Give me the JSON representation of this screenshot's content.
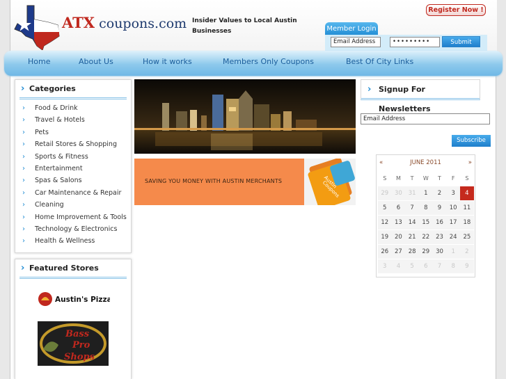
{
  "header": {
    "logo_text_a": "ATX",
    "logo_text_b": " coupons.com",
    "tagline": "Insider Values to Local Austin Businesses",
    "register_label": "Register Now !",
    "member_login_label": "Member Login",
    "email_value": "Email Address",
    "password_value": "•••••••••",
    "submit_label": "Submit"
  },
  "nav": {
    "items": [
      "Home",
      "About Us",
      "How it works",
      "Members Only Coupons",
      "Best Of City Links"
    ]
  },
  "categories": {
    "title": "Categories",
    "items": [
      "Food & Drink",
      "Travel & Hotels",
      "Pets",
      "Retail Stores & Shopping",
      "Sports & Fitness",
      "Entertainment",
      "Spas & Salons",
      "Car Maintenance & Repair",
      "Cleaning",
      "Home Improvement & Tools",
      "Technology & Electronics",
      "Health & Wellness"
    ]
  },
  "featured": {
    "title": "Featured Stores",
    "store1": "Austin's Pizza",
    "store2_a": "Bass",
    "store2_b": "Pro",
    "store2_c": "Shops"
  },
  "promo": {
    "text": "SAVING YOU MONEY WITH AUSTIN MERCHANTS",
    "card_a": "Austin",
    "card_b": "Coupons"
  },
  "newsletter": {
    "title": "Signup For Newsletters",
    "email_value": "Email Address",
    "subscribe_label": "Subscribe"
  },
  "calendar": {
    "prev": "«",
    "next": "»",
    "month": "JUNE 2011",
    "dow": [
      "S",
      "M",
      "T",
      "W",
      "T",
      "F",
      "S"
    ],
    "weeks": [
      [
        "29",
        "30",
        "31",
        "1",
        "2",
        "3",
        "4"
      ],
      [
        "5",
        "6",
        "7",
        "8",
        "9",
        "10",
        "11"
      ],
      [
        "12",
        "13",
        "14",
        "15",
        "16",
        "17",
        "18"
      ],
      [
        "19",
        "20",
        "21",
        "22",
        "23",
        "24",
        "25"
      ],
      [
        "26",
        "27",
        "28",
        "29",
        "30",
        "1",
        "2"
      ],
      [
        "3",
        "4",
        "5",
        "6",
        "7",
        "8",
        "9"
      ]
    ],
    "today": "4",
    "colors": {
      "today": "#c52a1d",
      "accent": "#1f8bd3",
      "brand_red": "#c0281e"
    }
  }
}
